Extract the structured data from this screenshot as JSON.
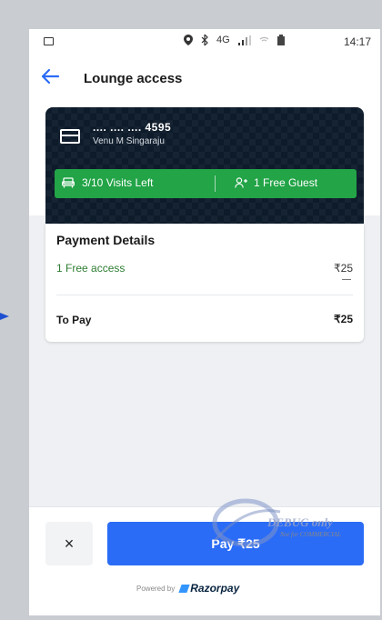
{
  "status_bar": {
    "network": "4G",
    "time": "14:17"
  },
  "header": {
    "title": "Lounge access"
  },
  "card": {
    "number": ".... .... .... 4595",
    "holder": "Venu M Singaraju",
    "visits_left": "3/10 Visits Left",
    "free_guest": "1 Free Guest"
  },
  "payment": {
    "title": "Payment Details",
    "free_access_label": "1 Free access",
    "free_access_value": "₹25",
    "to_pay_label": "To Pay",
    "to_pay_value": "₹25"
  },
  "footer": {
    "close_label": "×",
    "pay_label": "Pay ₹25",
    "powered_by": "Powered by",
    "brand": "Razorpay"
  },
  "watermark": {
    "line1": "DEBUG only",
    "line2": "Not for COMMERCIAL"
  },
  "colors": {
    "accent": "#2b6cf6",
    "card_bg": "#0d1b2a",
    "visits_green": "#22a447",
    "free_text": "#2e7d32"
  }
}
